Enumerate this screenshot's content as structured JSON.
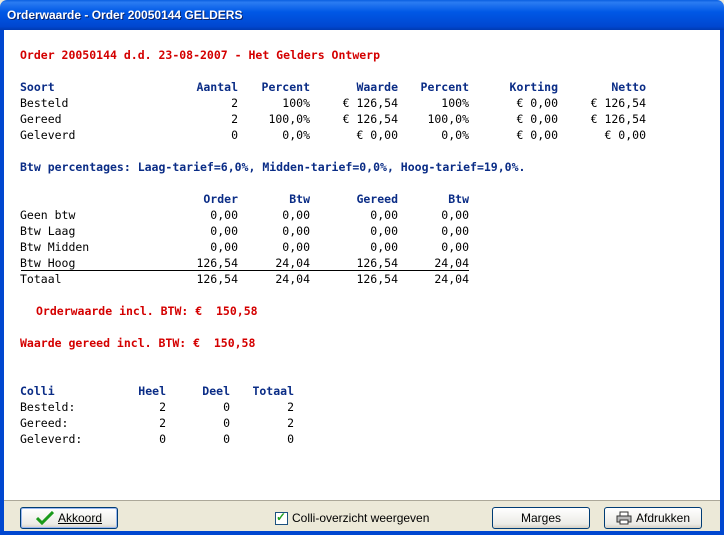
{
  "window": {
    "title": "Orderwaarde - Order 20050144 GELDERS"
  },
  "report": {
    "order_header": "Order 20050144 d.d. 23-08-2007 - Het Gelders Ontwerp",
    "summary": {
      "headers": [
        "Soort",
        "Aantal",
        "Percent",
        "Waarde",
        "Percent",
        "Korting",
        "Netto"
      ],
      "rows": [
        [
          "Besteld",
          "2",
          "100%",
          "€ 126,54",
          "100%",
          "€ 0,00",
          "€ 126,54"
        ],
        [
          "Gereed",
          "2",
          "100,0%",
          "€ 126,54",
          "100,0%",
          "€ 0,00",
          "€ 126,54"
        ],
        [
          "Geleverd",
          "0",
          "0,0%",
          "€ 0,00",
          "0,0%",
          "€ 0,00",
          "€ 0,00"
        ]
      ]
    },
    "btw_line": "Btw percentages: Laag-tarief=6,0%, Midden-tarief=0,0%, Hoog-tarief=19,0%.",
    "btw": {
      "headers": [
        "Order",
        "Btw",
        "Gereed",
        "Btw"
      ],
      "rows": [
        [
          "Geen btw",
          "0,00",
          "0,00",
          "0,00",
          "0,00"
        ],
        [
          "Btw Laag",
          "0,00",
          "0,00",
          "0,00",
          "0,00"
        ],
        [
          "Btw Midden",
          "0,00",
          "0,00",
          "0,00",
          "0,00"
        ],
        [
          "Btw Hoog",
          "126,54",
          "24,04",
          "126,54",
          "24,04"
        ]
      ],
      "total": [
        "Totaal",
        "126,54",
        "24,04",
        "126,54",
        "24,04"
      ]
    },
    "orderwaarde": "Orderwaarde incl. BTW: €  150,58",
    "waarde_gereed": "Waarde gereed incl. BTW: €  150,58",
    "colli": {
      "headers": [
        "Colli",
        "Heel",
        "Deel",
        "Totaal"
      ],
      "rows": [
        [
          "Besteld:",
          "2",
          "0",
          "2"
        ],
        [
          "Gereed:",
          "2",
          "0",
          "2"
        ],
        [
          "Geleverd:",
          "0",
          "0",
          "0"
        ]
      ]
    }
  },
  "footer": {
    "ok_label": "Akkoord",
    "checkbox_label": "Colli-overzicht weergeven",
    "checkbox_checked": true,
    "marges_label": "Marges",
    "print_label": "Afdrukken"
  }
}
